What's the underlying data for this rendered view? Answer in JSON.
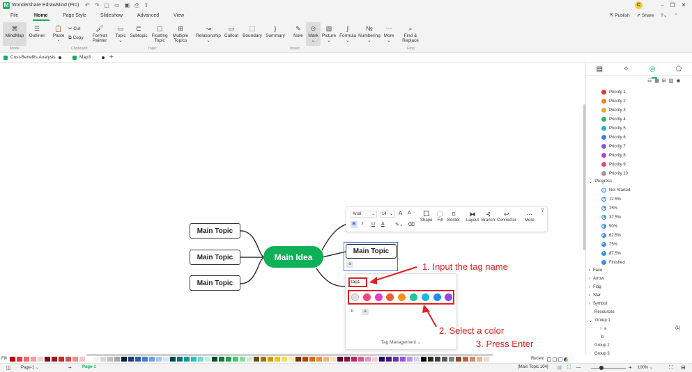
{
  "app": {
    "title": "Wondershare EdrawMind (Pro)",
    "logo_letter": "M",
    "user_initial": "C",
    "publish": "Publish",
    "share": "Share"
  },
  "menu": [
    "File",
    "Home",
    "Page Style",
    "Slideshow",
    "Advanced",
    "View"
  ],
  "ribbon": {
    "mindmap": "MindMap",
    "outliner": "Outliner",
    "paste": "Paste",
    "cut": "Cut",
    "copy": "Copy",
    "format_painter": "Format\nPainter",
    "topic": "Topic",
    "subtopic": "Subtopic",
    "floating_topic": "Floating\nTopic",
    "multiple_topics": "Multiple\nTopics",
    "relationship": "Relationship",
    "callout": "Callout",
    "boundary": "Boundary",
    "summary": "Summary",
    "note": "Note",
    "mark": "Mark",
    "picture": "Picture",
    "formula": "Formula",
    "numbering": "Numbering",
    "more": "More",
    "find_replace": "Find &\nReplace",
    "groups": {
      "mode": "Mode",
      "clipboard": "Clipboard",
      "topic": "Topic",
      "insert": "Insert",
      "find": "Find"
    }
  },
  "doctabs": [
    "Cost-Benefits Analysis",
    "Map3"
  ],
  "canvas": {
    "main_idea": "Main Idea",
    "left_topics": [
      "Main Topic",
      "Main Topic",
      "Main Topic"
    ],
    "selected_topic": "Main Topic",
    "tag_stub": "a"
  },
  "float_toolbar": {
    "font": "Arial",
    "size": "14",
    "bold": "B",
    "italic": "I",
    "underline": "U",
    "font_color": "A",
    "font_up": "A",
    "font_down": "A",
    "items": [
      "Shape",
      "Fill",
      "Border",
      "Layout",
      "Branch",
      "Connector",
      "More"
    ]
  },
  "tag_popup": {
    "input_value": "tag1",
    "colors": [
      "#e2e2e2",
      "#f0457b",
      "#e83ad1",
      "#f15a2c",
      "#f7941d",
      "#1ec7a0",
      "#1ab5e8",
      "#1e8ff0",
      "#9a46e8"
    ],
    "chips": [
      "b",
      "a"
    ],
    "footer": "Tag Management"
  },
  "annotations": {
    "step1": "1. Input the tag name",
    "step2": "2. Select a color",
    "step3": "3. Press Enter"
  },
  "panel": {
    "priorities": [
      {
        "label": "Priority 1",
        "color": "#e8382c"
      },
      {
        "label": "Priority 2",
        "color": "#f7811e"
      },
      {
        "label": "Priority 3",
        "color": "#f5a623"
      },
      {
        "label": "Priority 4",
        "color": "#2bb673"
      },
      {
        "label": "Priority 5",
        "color": "#1fb5c9"
      },
      {
        "label": "Priority 6",
        "color": "#3f7fe6"
      },
      {
        "label": "Priority 7",
        "color": "#8a55e6"
      },
      {
        "label": "Priority 8",
        "color": "#b048c8"
      },
      {
        "label": "Priority 9",
        "color": "#e8478a"
      },
      {
        "label": "Priority 10",
        "color": "#9b9b9b"
      }
    ],
    "progress_title": "Progress",
    "progress": [
      "Not Started",
      "12.5%",
      "25%",
      "37.5%",
      "50%",
      "62.5%",
      "75%",
      "87.5%",
      "Finished"
    ],
    "sections": [
      "Face",
      "Arrow",
      "Flag",
      "Star",
      "Symbol",
      "Resources"
    ],
    "group1": "Group 1",
    "group1_items": [
      "a",
      "b"
    ],
    "group1_count": "(1)",
    "groups_more": [
      "Group 2",
      "Group 3"
    ]
  },
  "palette": {
    "fill_label": "Fill",
    "recent": "Recent",
    "colors": [
      "#c00000",
      "#e03c3c",
      "#f06b6b",
      "#f59c9c",
      "#fbd0d0",
      "#7a1010",
      "#a01818",
      "#c82a2a",
      "#d85454",
      "#e89090",
      "#f4c6c6",
      "#ffffff",
      "#f2f2f2",
      "#d9d9d9",
      "#bfbfbf",
      "#a6a6a6",
      "#0d1f4a",
      "#1d3a7a",
      "#2a5caa",
      "#3f7fd6",
      "#6da3ea",
      "#a7c8f4",
      "#d5e6fb",
      "#074a4a",
      "#0a7070",
      "#109a9a",
      "#28c0b8",
      "#6fdad3",
      "#b9eeea",
      "#0a4d20",
      "#127a35",
      "#1fa34c",
      "#44c46e",
      "#86dca0",
      "#c8f0d4",
      "#6b4c00",
      "#a07300",
      "#d19c00",
      "#f2c200",
      "#f7dc5c",
      "#fbeeaa",
      "#7a2e00",
      "#b54600",
      "#e06a10",
      "#f08c3c",
      "#f6b47c",
      "#fbdcbc",
      "#5a0a2a",
      "#8a1444",
      "#b82a64",
      "#d8588c",
      "#eb93b6",
      "#f6cadc",
      "#2a0a5a",
      "#44168a",
      "#6a30b8",
      "#9058d8",
      "#b892ec",
      "#dccaf8",
      "#000000",
      "#262626",
      "#404040",
      "#595959",
      "#7f7f7f",
      "#8c4a2a",
      "#b06a44",
      "#d08c64",
      "#e8b494",
      "#f6dac8"
    ]
  },
  "statusbar": {
    "page_select": "Page-1",
    "page_tab": "Page-1",
    "selected": "[Main Topic 104]",
    "zoom": "100%"
  }
}
